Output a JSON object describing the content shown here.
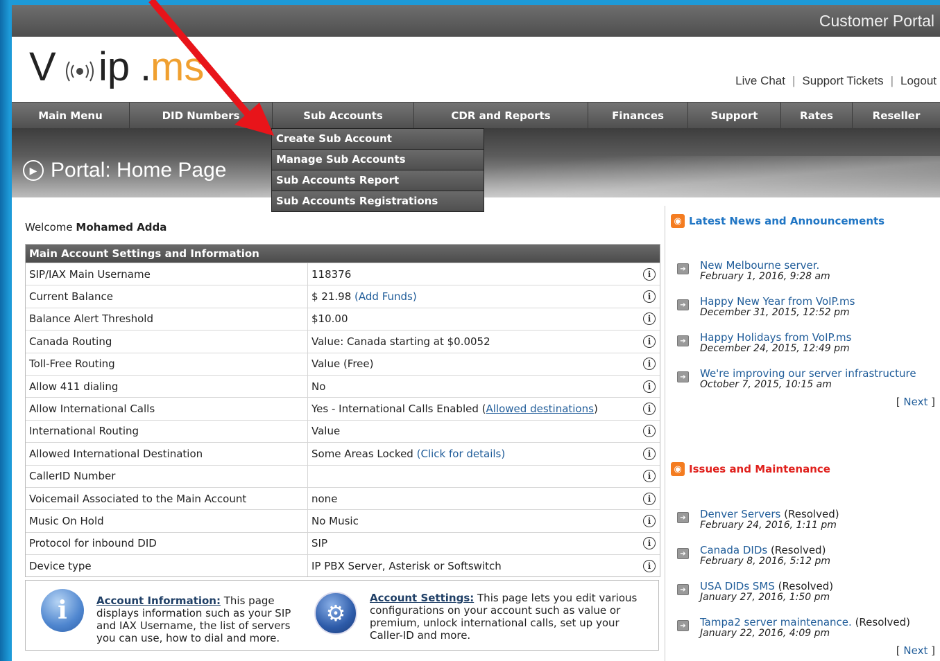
{
  "header": {
    "portal_title": "Customer Portal",
    "logo": {
      "v": "V",
      "ip": "ip",
      "dot": ".",
      "ms": "ms"
    },
    "links": {
      "live_chat": "Live Chat",
      "sep": "|",
      "support_tickets": "Support Tickets",
      "logout": "Logout"
    }
  },
  "nav": {
    "items": [
      {
        "label": "Main Menu"
      },
      {
        "label": "DID Numbers"
      },
      {
        "label": "Sub Accounts"
      },
      {
        "label": "CDR and Reports"
      },
      {
        "label": "Finances"
      },
      {
        "label": "Support"
      },
      {
        "label": "Rates"
      },
      {
        "label": "Reseller"
      }
    ]
  },
  "dropdown": {
    "items": [
      {
        "label": "Create Sub Account"
      },
      {
        "label": "Manage Sub Accounts"
      },
      {
        "label": "Sub Accounts Report"
      },
      {
        "label": "Sub Accounts Registrations"
      }
    ]
  },
  "banner": {
    "title": "Portal: Home Page"
  },
  "welcome": {
    "prefix": "Welcome",
    "name": "Mohamed Adda"
  },
  "settings": {
    "heading": "Main Account Settings and Information",
    "rows": [
      {
        "label": "SIP/IAX Main Username",
        "value": "118376"
      },
      {
        "label": "Current Balance",
        "value": "$ 21.98",
        "link": "(Add Funds)"
      },
      {
        "label": "Balance Alert Threshold",
        "value": "$10.00"
      },
      {
        "label": "Canada Routing",
        "value": "Value: Canada starting at $0.0052"
      },
      {
        "label": "Toll-Free Routing",
        "value": "Value (Free)"
      },
      {
        "label": "Allow 411 dialing",
        "value": "No"
      },
      {
        "label": "Allow International Calls",
        "value": "Yes - International Calls Enabled",
        "link_open": "(",
        "link": "Allowed destinations",
        "link_close": ")"
      },
      {
        "label": "International Routing",
        "value": "Value"
      },
      {
        "label": "Allowed International Destination",
        "value": "Some Areas Locked",
        "link": "(Click for details)"
      },
      {
        "label": "CallerID Number",
        "value": ""
      },
      {
        "label": "Voicemail Associated to the Main Account",
        "value": "none"
      },
      {
        "label": "Music On Hold",
        "value": "No Music"
      },
      {
        "label": "Protocol for inbound DID",
        "value": "SIP"
      },
      {
        "label": "Device type",
        "value": "IP PBX Server, Asterisk or Softswitch"
      }
    ],
    "info_glyph": "i"
  },
  "boxes": {
    "account_info": {
      "title": "Account Information:",
      "text": " This page displays information such as your SIP and IAX Username, the list of servers you can use, how to dial and more."
    },
    "account_settings": {
      "title": "Account Settings:",
      "text": " This page lets you edit various configurations on your account such as value or premium, unlock international calls, set up your Caller-ID and more."
    }
  },
  "news": {
    "heading": "Latest News and Announcements",
    "items": [
      {
        "title": "New Melbourne server.",
        "date": "February 1, 2016, 9:28 am"
      },
      {
        "title": "Happy New Year from VoIP.ms",
        "date": "December 31, 2015, 12:52 pm"
      },
      {
        "title": "Happy Holidays from VoIP.ms",
        "date": "December 24, 2015, 12:49 pm"
      },
      {
        "title": "We're improving our server infrastructure",
        "date": "October 7, 2015, 10:15 am"
      }
    ],
    "next": "Next"
  },
  "issues": {
    "heading": "Issues and Maintenance",
    "items": [
      {
        "title": "Denver Servers",
        "status": " (Resolved)",
        "date": "February 24, 2016, 1:11 pm"
      },
      {
        "title": "Canada DIDs",
        "status": " (Resolved)",
        "date": "February 8, 2016, 5:12 pm"
      },
      {
        "title": "USA DIDs SMS",
        "status": " (Resolved)",
        "date": "January 27, 2016, 1:50 pm"
      },
      {
        "title": "Tampa2 server maintenance.",
        "status": " (Resolved)",
        "date": "January 22, 2016, 4:09 pm"
      }
    ],
    "next": "Next"
  },
  "colors": {
    "accent_blue": "#1f5c99",
    "news_heading": "#1f75c4",
    "issues_heading": "#e0201c",
    "rss_orange": "#f47c20",
    "annotation_red": "#e8141a",
    "logo_orange": "#f0a030"
  },
  "icons": {
    "rss": "rss-icon",
    "arrow": "arrow-right-icon",
    "info": "info-icon",
    "gear": "gear-icon",
    "play": "play-circle-icon"
  }
}
